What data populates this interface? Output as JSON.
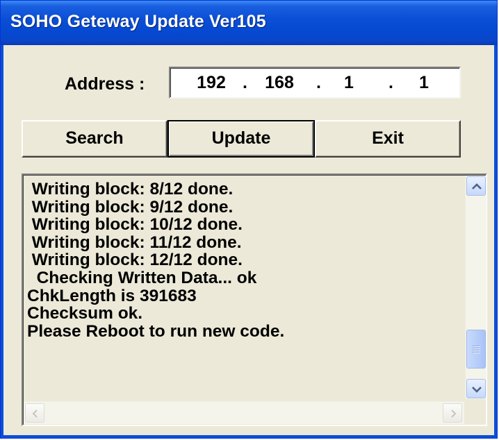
{
  "window": {
    "title": "SOHO Geteway Update Ver105"
  },
  "address": {
    "label": "Address :",
    "octets": [
      "192",
      "168",
      "1",
      "1"
    ],
    "separator": "."
  },
  "buttons": {
    "search": "Search",
    "update": "Update",
    "exit": "Exit"
  },
  "log": {
    "lines": [
      " Writing block: 8/12 done.",
      " Writing block: 9/12 done.",
      " Writing block: 10/12 done.",
      " Writing block: 11/12 done.",
      " Writing block: 12/12 done.",
      "  Checking Written Data... ok",
      "ChkLength is 391683",
      "Checksum ok.",
      "Please Reboot to run new code."
    ]
  },
  "icons": {
    "scroll_up": "chevron-up-icon",
    "scroll_down": "chevron-down-icon",
    "scroll_left": "chevron-left-icon",
    "scroll_right": "chevron-right-icon"
  },
  "colors": {
    "title_bar": "#0a4fd6",
    "window_face": "#ece9d8",
    "scroll_accent": "#4d6185"
  }
}
